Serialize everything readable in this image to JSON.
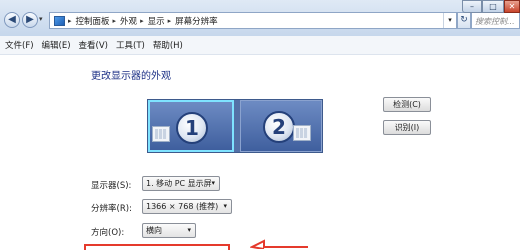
{
  "window": {
    "minimize_icon": "minimize-icon",
    "maximize_icon": "maximize-icon",
    "close_icon": "close-icon",
    "minimize_glyph": "–",
    "maximize_glyph": "□",
    "close_glyph": "✕"
  },
  "address_bar": {
    "breadcrumbs": [
      "控制面板",
      "外观",
      "显示",
      "屏幕分辨率"
    ],
    "separator": "▸",
    "search_placeholder": "搜索控制..."
  },
  "menu": {
    "items": [
      "文件(F)",
      "编辑(E)",
      "查看(V)",
      "工具(T)",
      "帮助(H)"
    ]
  },
  "main": {
    "heading": "更改显示器的外观",
    "monitors": [
      {
        "number": "1",
        "selected": true
      },
      {
        "number": "2",
        "selected": false
      }
    ],
    "detect_button": "检测(C)",
    "identify_button": "识别(I)",
    "display_label": "显示器(S):",
    "display_value": "1. 移动 PC 显示屏",
    "resolution_label": "分辨率(R):",
    "resolution_value": "1366 × 768 (推荐)",
    "orientation_label": "方向(O):",
    "orientation_value": "横向"
  },
  "colors": {
    "annotation_red": "#e53a2c",
    "monitor_selected_border": "#7fe3ff",
    "heading_blue": "#1e3287"
  }
}
